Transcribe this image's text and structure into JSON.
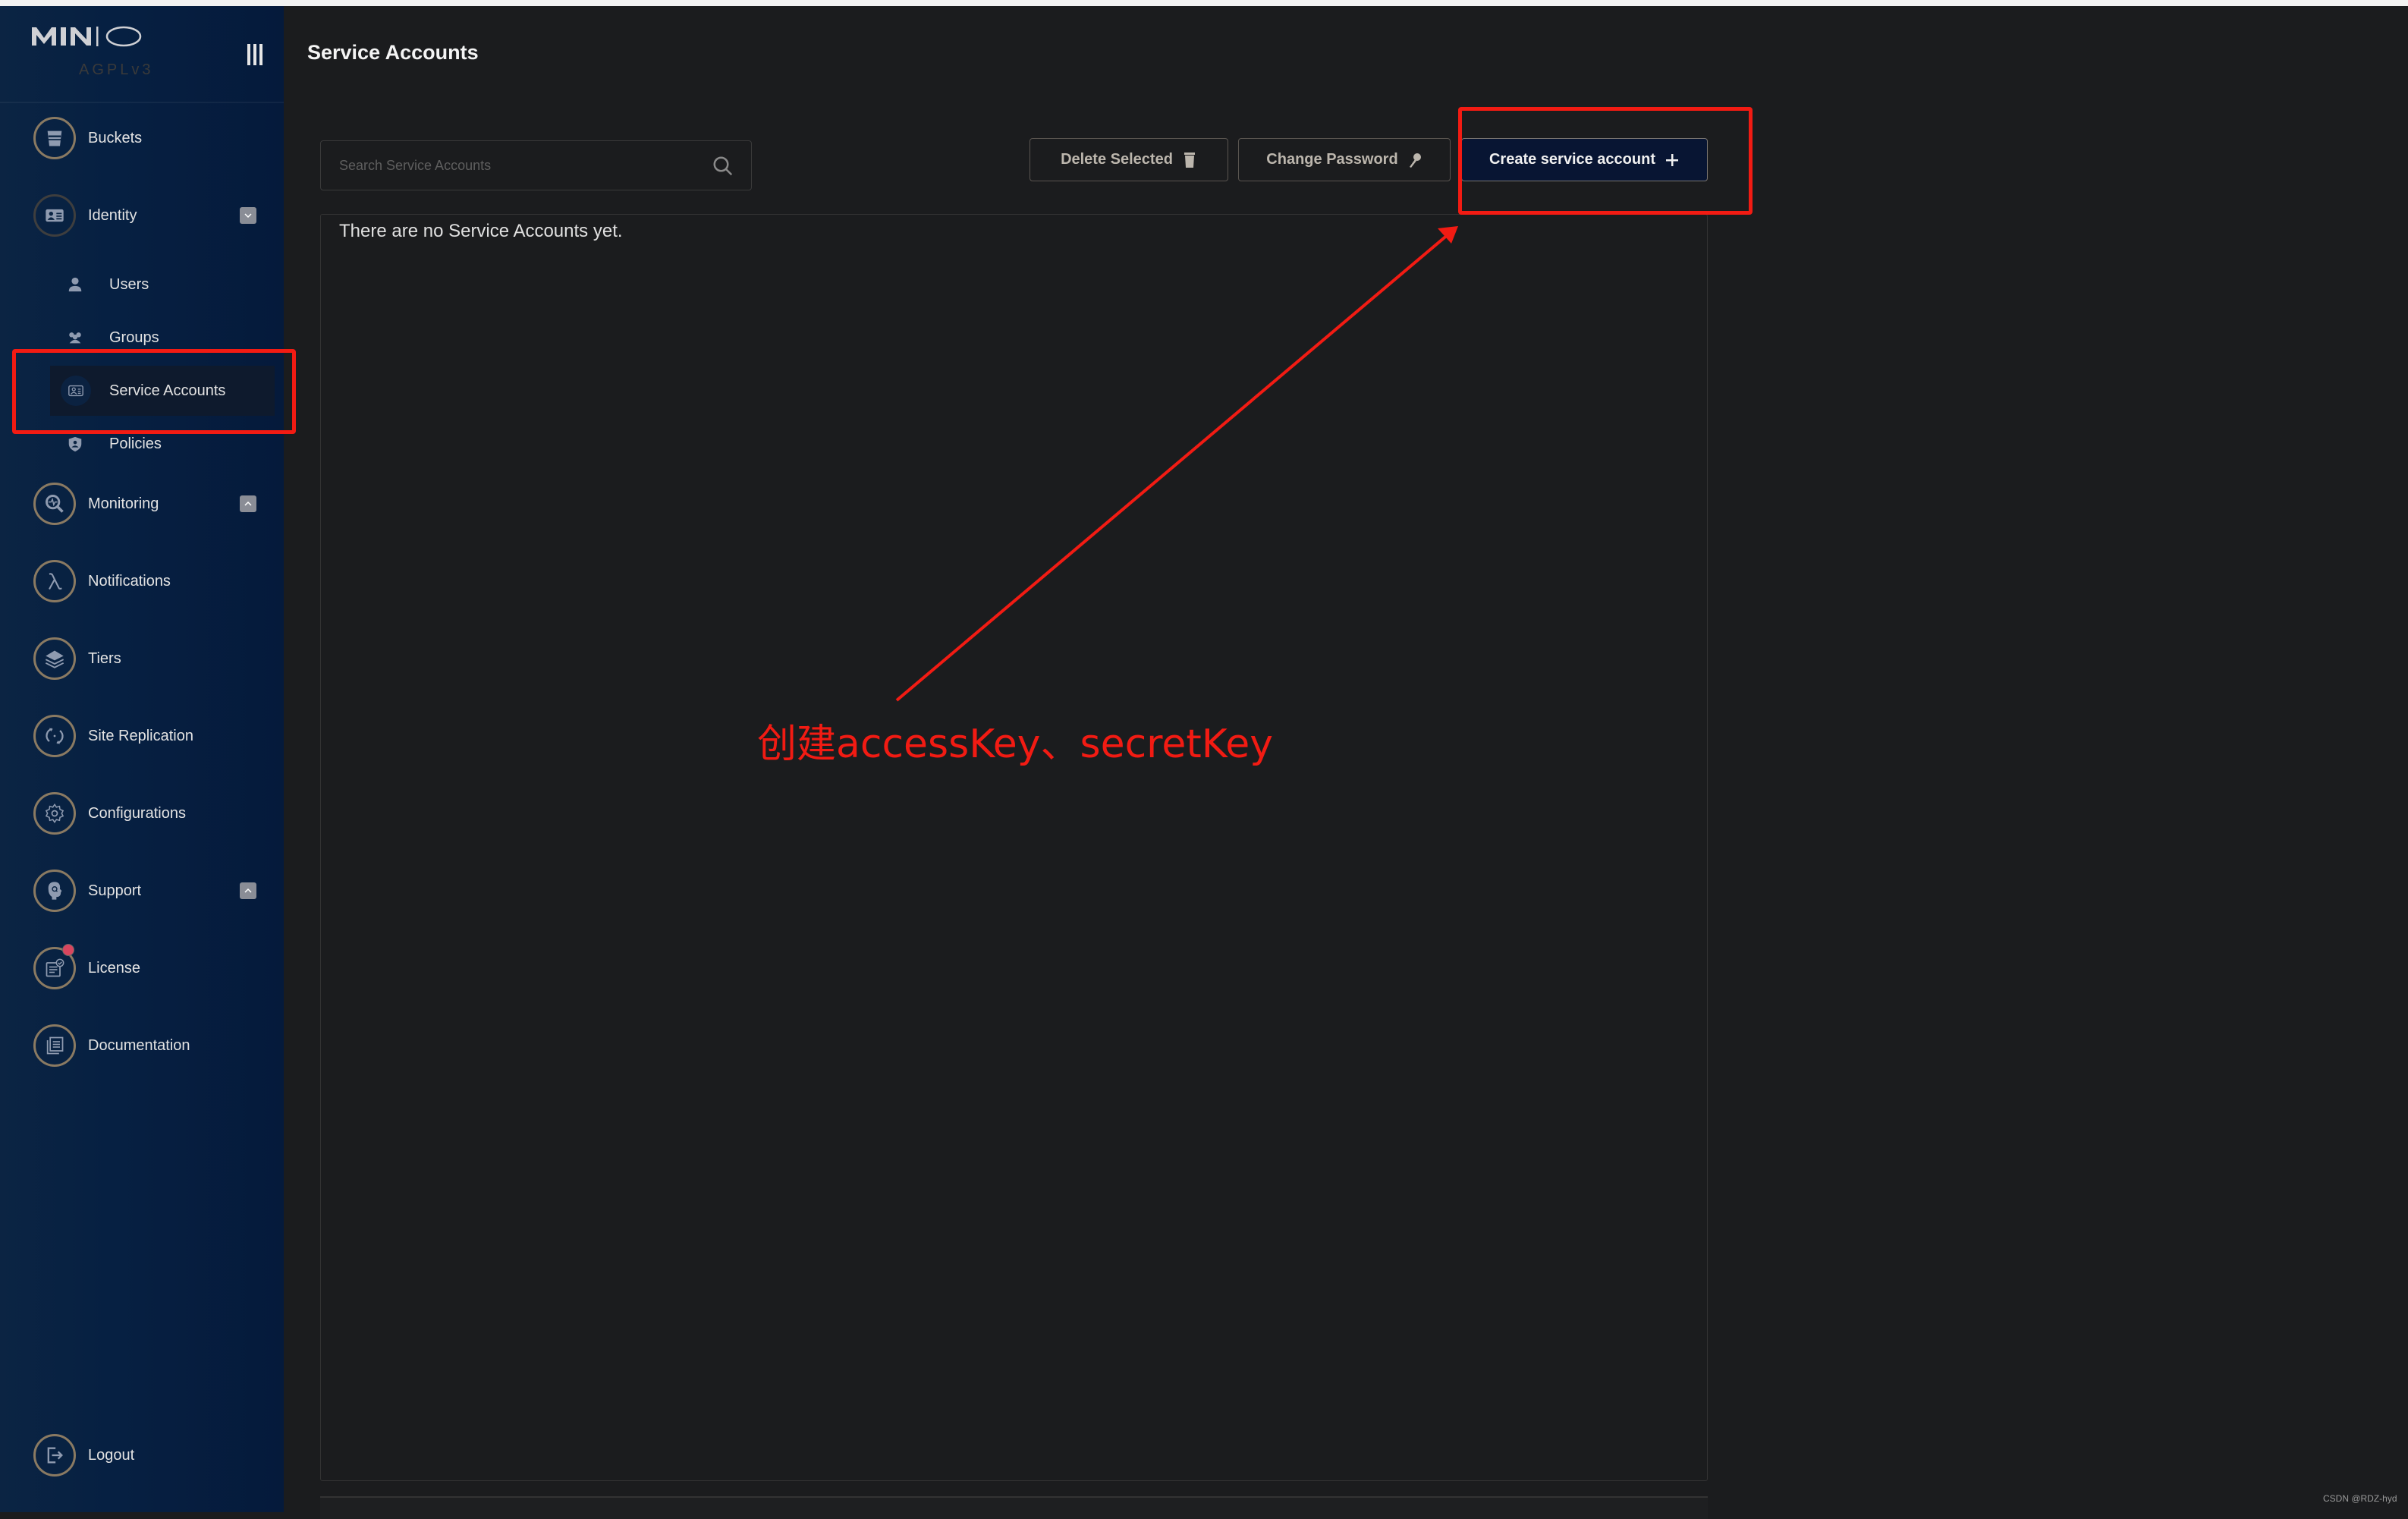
{
  "sidebar": {
    "logo_text": "MINIO",
    "license_tag": "AGPLv3",
    "items": [
      {
        "label": "Buckets",
        "icon": "bucket-icon"
      },
      {
        "label": "Identity",
        "icon": "id-card-icon",
        "toggle": "collapse"
      },
      {
        "label": "Monitoring",
        "icon": "monitoring-icon",
        "toggle": "expand"
      },
      {
        "label": "Notifications",
        "icon": "lambda-icon"
      },
      {
        "label": "Tiers",
        "icon": "layers-icon"
      },
      {
        "label": "Site Replication",
        "icon": "sync-icon"
      },
      {
        "label": "Configurations",
        "icon": "gear-icon"
      },
      {
        "label": "Support",
        "icon": "support-icon",
        "toggle": "expand"
      },
      {
        "label": "License",
        "icon": "license-icon",
        "badge": true
      },
      {
        "label": "Documentation",
        "icon": "documentation-icon"
      }
    ],
    "identity_sub_items": [
      {
        "label": "Users",
        "icon": "user-icon"
      },
      {
        "label": "Groups",
        "icon": "groups-icon"
      },
      {
        "label": "Service Accounts",
        "icon": "service-account-icon",
        "active": true
      },
      {
        "label": "Policies",
        "icon": "policy-shield-icon"
      }
    ],
    "logout_label": "Logout"
  },
  "header": {
    "title": "Service Accounts"
  },
  "toolbar": {
    "search_placeholder": "Search Service Accounts",
    "search_value": "",
    "delete_label": "Delete Selected",
    "change_password_label": "Change Password",
    "create_label": "Create service account"
  },
  "table": {
    "empty_message": "There are no Service Accounts yet."
  },
  "annotation": {
    "text": "创建accessKey、secretKey",
    "color": "#f21b13"
  },
  "watermark": "CSDN @RDZ-hyd",
  "colors": {
    "sidebar_bg": "#062042",
    "main_bg": "#1b1c1e",
    "primary_button": "#081533",
    "icon_ring": "#8a7a62",
    "badge": "#d9465f"
  }
}
